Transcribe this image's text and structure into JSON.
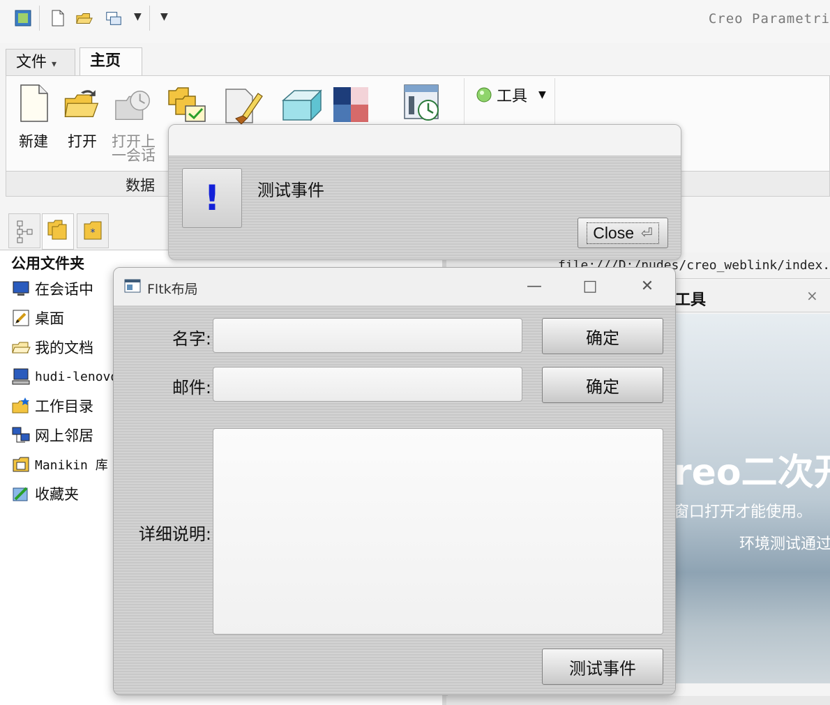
{
  "app": {
    "title": "Creo Parametri"
  },
  "ribbon": {
    "tabs": [
      {
        "label": "文件"
      },
      {
        "label": "主页"
      }
    ],
    "file_arrow": "▾",
    "buttons": {
      "new": "新建",
      "open": "打开",
      "open_last_line1": "打开上",
      "open_last_line2": "一会话"
    },
    "tools_label": "工具",
    "tools_arrow": "▼",
    "group_label": "数据"
  },
  "navigator": {
    "header": "公用文件夹",
    "items": [
      {
        "label": "在会话中",
        "icon": "monitor-icon"
      },
      {
        "label": "桌面",
        "icon": "desktop-icon"
      },
      {
        "label": "我的文档",
        "icon": "my-documents-icon"
      },
      {
        "label": "hudi-lenovo",
        "icon": "computer-icon"
      },
      {
        "label": "工作目录",
        "icon": "working-directory-icon"
      },
      {
        "label": "网上邻居",
        "icon": "network-icon"
      },
      {
        "label": "Manikin 库",
        "icon": "manikin-library-icon"
      },
      {
        "label": "收藏夹",
        "icon": "favorites-icon"
      }
    ]
  },
  "browser": {
    "url": "file:///D:/nudes/creo_weblink/index.h",
    "tool_tab_label": "工具",
    "tool_tab_close": "×",
    "banner_title": "reo二次开",
    "banner_sub1": "窗口打开才能使用。",
    "banner_sub2": "环境测试通过"
  },
  "message_box": {
    "icon_symbol": "!",
    "message": "测试事件",
    "close_label": "Close",
    "close_glyph": "⏎"
  },
  "fltk_window": {
    "title": "Fltk布局",
    "minimize_glyph": "—",
    "maximize_glyph": "□",
    "close_glyph": "✕",
    "name_label": "名字:",
    "name_value": "",
    "mail_label": "邮件:",
    "mail_value": "",
    "detail_label": "详细说明:",
    "confirm_label_1": "确定",
    "confirm_label_2": "确定",
    "test_button_label": "测试事件"
  }
}
